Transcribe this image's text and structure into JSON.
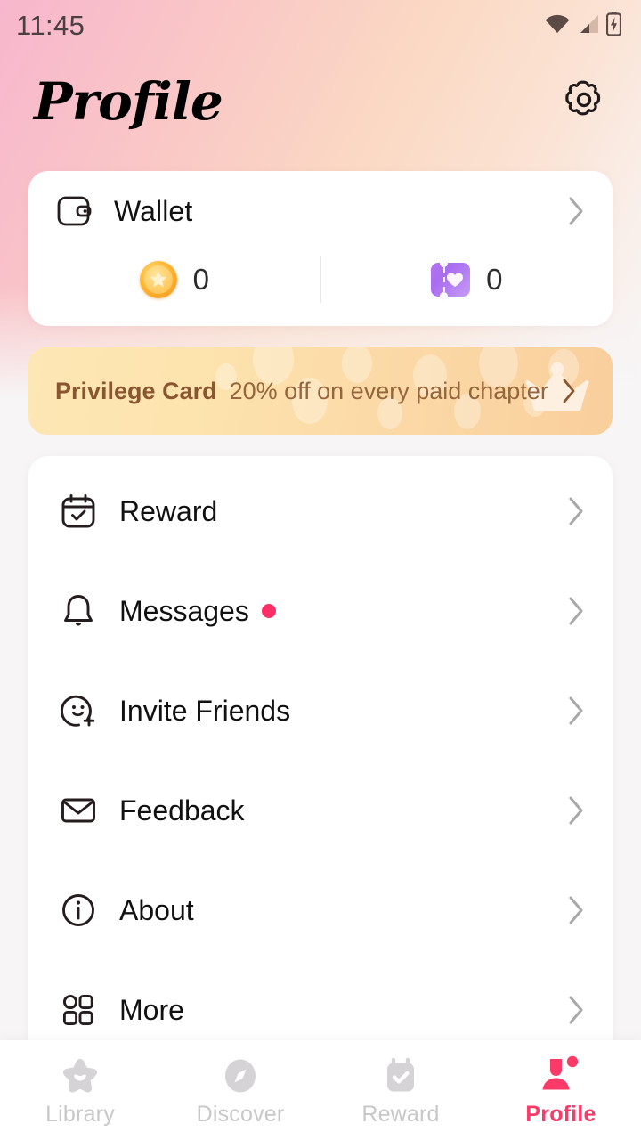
{
  "statusbar": {
    "time": "11:45",
    "icons": [
      "wifi-icon",
      "cellular-signal-icon",
      "battery-charging-icon"
    ]
  },
  "header": {
    "title": "Profile",
    "settings_icon": "gear-icon"
  },
  "wallet": {
    "icon": "wallet-icon",
    "label": "Wallet",
    "chevron": "chevron-right-icon",
    "stats": [
      {
        "icon": "coin-star-icon",
        "value": "0"
      },
      {
        "icon": "ticket-heart-icon",
        "value": "0"
      }
    ]
  },
  "privilege": {
    "title": "Privilege Card",
    "subtitle": "20% off on every paid chapter",
    "chevron": "chevron-right-icon",
    "decor_icon": "crown-icon"
  },
  "menu": {
    "items": [
      {
        "icon": "calendar-check-icon",
        "label": "Reward",
        "badge": false
      },
      {
        "icon": "bell-icon",
        "label": "Messages",
        "badge": true
      },
      {
        "icon": "smiley-plus-icon",
        "label": "Invite Friends",
        "badge": false
      },
      {
        "icon": "envelope-icon",
        "label": "Feedback",
        "badge": false
      },
      {
        "icon": "info-circle-icon",
        "label": "About",
        "badge": false
      },
      {
        "icon": "grid-icon",
        "label": "More",
        "badge": false
      }
    ]
  },
  "bottomnav": {
    "items": [
      {
        "icon": "star-smile-icon",
        "label": "Library",
        "active": false,
        "badge": false
      },
      {
        "icon": "compass-icon",
        "label": "Discover",
        "active": false,
        "badge": false
      },
      {
        "icon": "calendar-check-icon",
        "label": "Reward",
        "active": false,
        "badge": false
      },
      {
        "icon": "person-icon",
        "label": "Profile",
        "active": true,
        "badge": true
      }
    ]
  },
  "colors": {
    "accent_pink": "#fc3a68",
    "badge_pink": "#fa3066",
    "gradient_start": "#f7b6cd",
    "gradient_end": "#f7f5f6",
    "banner_start": "#fde7b4",
    "banner_end": "#f9cf9c",
    "banner_text": "#8a5630",
    "nav_inactive": "#c9c7c9",
    "card_bg": "#ffffff"
  }
}
